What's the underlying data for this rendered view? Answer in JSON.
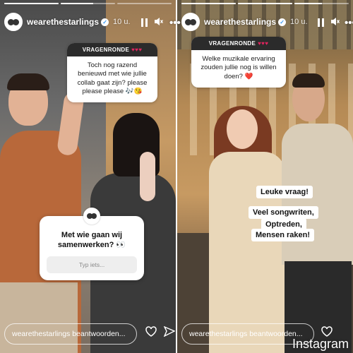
{
  "left_story": {
    "progress": [
      1.0,
      0.6,
      0.0
    ],
    "username": "wearethestarlings",
    "time": "10 u.",
    "question_header": "VRAGENRONDE",
    "question_hearts": "♥♥♥",
    "question_text": "Toch nog razend benieuwd met wie jullie collab gaat zijn? please please please 🎶😘",
    "ask_title": "Met wie gaan wij samenwerken? 👀",
    "ask_placeholder": "Typ iets...",
    "reply_text": "wearethestarlings beantwoorden..."
  },
  "right_story": {
    "progress": [
      1.0,
      1.0,
      0.5
    ],
    "username": "wearethestarlings",
    "time": "10 u.",
    "question_header": "VRAGENRONDE",
    "question_hearts": "♥♥♥",
    "question_text": "Welke muzikale ervaring zouden jullie nog is willen doen? ❤️",
    "answer_1": "Leuke vraag!",
    "answer_2": "Veel songwriten,",
    "answer_3": "Optreden,",
    "answer_4": "Mensen raken!",
    "reply_text": "wearethestarlings beantwoorden..."
  },
  "watermark": "Instagram",
  "icons": {
    "pause": "pause-icon",
    "mute": "speaker-muted-icon",
    "more": "more-icon",
    "heart": "heart-icon",
    "send": "send-icon",
    "verified": "verified-badge-icon"
  },
  "colors": {
    "hearts": "#e0245e",
    "verified": "#3897f0"
  }
}
